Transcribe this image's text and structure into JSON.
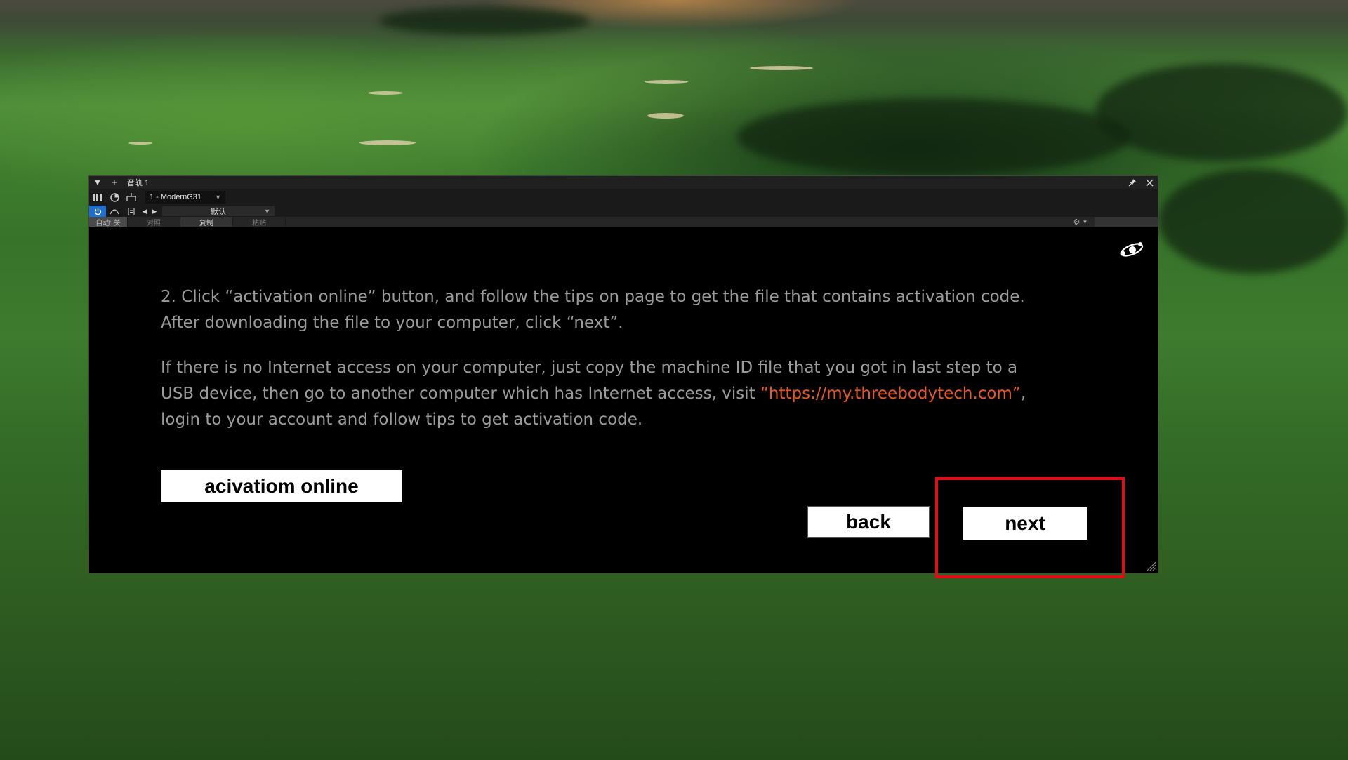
{
  "window": {
    "title": "音轨 1",
    "preset_name": "1 - ModernG31",
    "preset_program": "默认",
    "auto_label": "自动: 关",
    "compare_label": "对照",
    "copy_label": "复制",
    "paste_label": "粘贴"
  },
  "dialog": {
    "step2_text": "2. Click “activation online” button, and follow the tips on page to get the file that contains activation code. After downloading the file to your computer, click “next”.",
    "offline_intro": "If there is no Internet access on your computer, just copy the machine ID file that you got in last step to a USB device, then go to another computer which has Internet access, visit ",
    "offline_link": "“https://my.threebodytech.com”",
    "offline_outro": ", login to your account and follow tips to get activation code.",
    "activation_button": "acivatiom online",
    "back_button": "back",
    "next_button": "next"
  },
  "colors": {
    "link": "#e7591e",
    "highlight": "#e00d18",
    "power_active": "#1d6fd1"
  },
  "icons": [
    "collapse-arrow-icon",
    "add-icon",
    "pin-icon",
    "close-icon",
    "bars-icon",
    "circle-icon",
    "routing-icon",
    "power-icon",
    "curve-icon",
    "page-icon",
    "prev-arrow-icon",
    "next-arrow-icon",
    "gear-icon",
    "brand-logo-icon",
    "resize-grip-icon"
  ]
}
